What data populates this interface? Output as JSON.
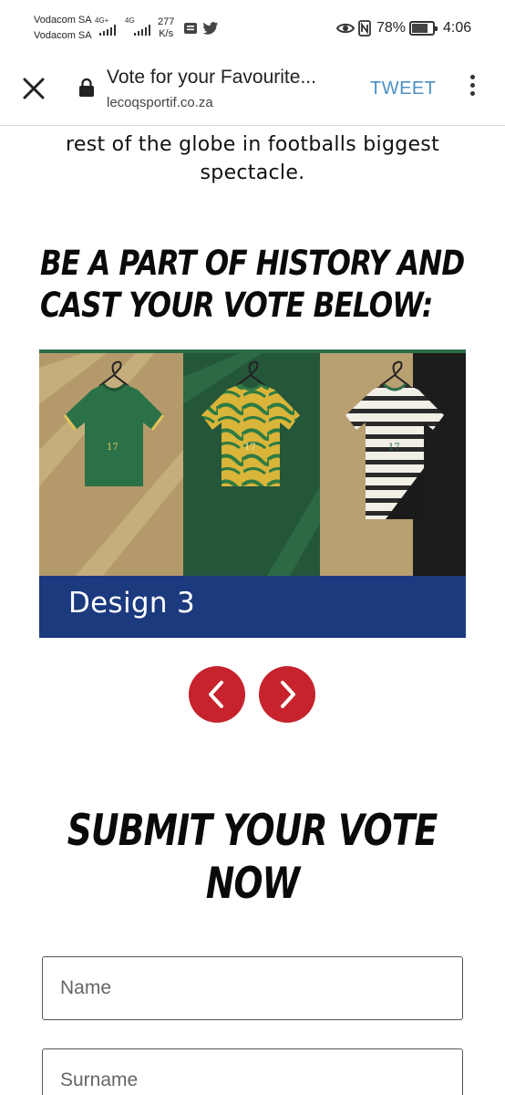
{
  "status_bar": {
    "carrier_1": "Vodacom SA",
    "carrier_2": "Vodacom SA",
    "net_1": "4G+",
    "net_2": "4G",
    "speed_value": "277",
    "speed_unit": "K/s",
    "battery_percent": "78%",
    "battery_level": 0.78,
    "time": "4:06"
  },
  "browser": {
    "page_title": "Vote for your Favourite...",
    "url": "lecoqsportif.co.za",
    "tweet_label": "TWEET"
  },
  "content": {
    "intro_line_1": "rest of the globe in footballs biggest",
    "intro_line_2": "spectacle.",
    "heading_line_1": "BE A PART OF HISTORY AND",
    "heading_line_2": "CAST YOUR VOTE BELOW:",
    "carousel": {
      "caption": "Design 3",
      "kit_numbers": [
        "17",
        "17",
        "17"
      ]
    },
    "submit_heading_line_1": "SUBMIT YOUR VOTE",
    "submit_heading_line_2": "NOW",
    "form": {
      "name_placeholder": "Name",
      "surname_placeholder": "Surname"
    }
  },
  "colors": {
    "accent_red": "#c6232c",
    "caption_blue": "#1c3a7e",
    "link_blue": "#4a90c8"
  },
  "icons": [
    "close-icon",
    "lock-icon",
    "more-vert-icon",
    "chevron-left-icon",
    "chevron-right-icon",
    "eye-icon",
    "nfc-icon",
    "battery-icon",
    "message-icon",
    "twitter-icon",
    "signal-icon"
  ]
}
